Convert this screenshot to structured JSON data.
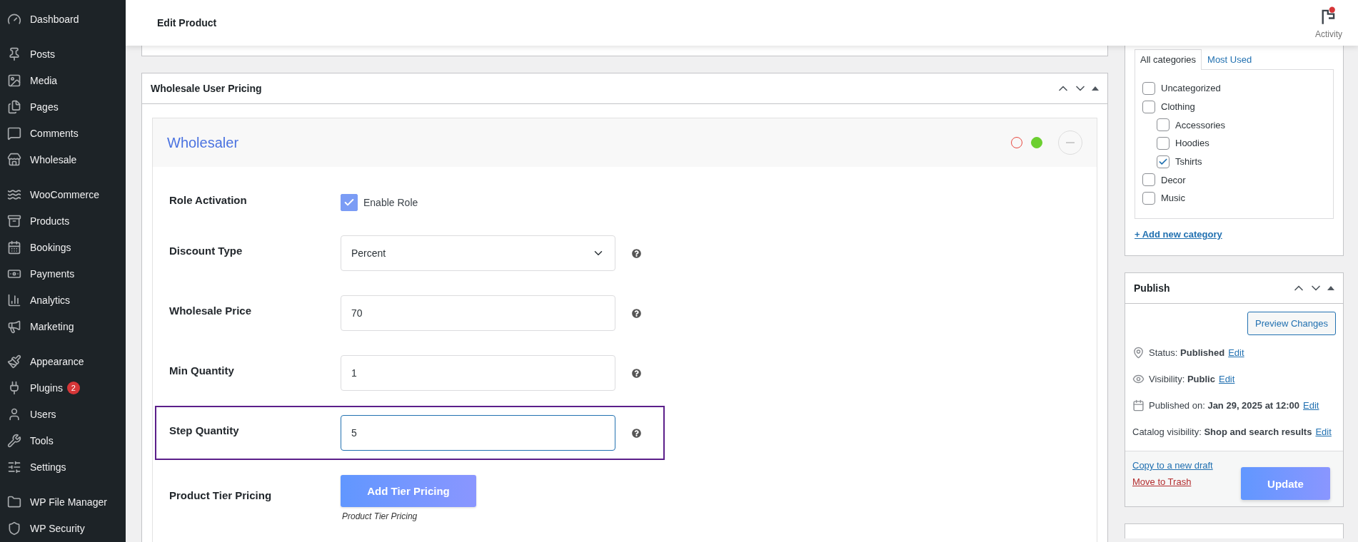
{
  "sidebar": {
    "groups": [
      {
        "items": [
          {
            "label": "Dashboard"
          }
        ]
      },
      {
        "items": [
          {
            "label": "Posts"
          },
          {
            "label": "Media"
          },
          {
            "label": "Pages"
          },
          {
            "label": "Comments"
          },
          {
            "label": "Wholesale"
          }
        ]
      },
      {
        "items": [
          {
            "label": "WooCommerce"
          },
          {
            "label": "Products"
          },
          {
            "label": "Bookings"
          },
          {
            "label": "Payments"
          },
          {
            "label": "Analytics"
          },
          {
            "label": "Marketing"
          }
        ]
      },
      {
        "items": [
          {
            "label": "Appearance"
          },
          {
            "label": "Plugins",
            "badge": "2"
          },
          {
            "label": "Users"
          },
          {
            "label": "Tools"
          },
          {
            "label": "Settings"
          }
        ]
      },
      {
        "items": [
          {
            "label": "WP File Manager"
          },
          {
            "label": "WP Security"
          }
        ]
      }
    ]
  },
  "header": {
    "title": "Edit Product",
    "activity": {
      "label": "Activity",
      "unread": true
    }
  },
  "wholesale_box": {
    "title": "Wholesale User Pricing",
    "role_card": {
      "name": "Wholesaler",
      "status_dots": [
        {
          "color": "#e8473f",
          "filled": false
        },
        {
          "color": "#6ccf30",
          "filled": true
        }
      ],
      "rows": [
        {
          "kind": "checkbox",
          "label": "Role Activation",
          "option": "Enable Role",
          "checked": true
        },
        {
          "kind": "select",
          "label": "Discount Type",
          "value": "Percent",
          "focused": false,
          "highlighted": false
        },
        {
          "kind": "input",
          "label": "Wholesale Price",
          "value": "70",
          "focused": false,
          "highlighted": false
        },
        {
          "kind": "input",
          "label": "Min Quantity",
          "value": "1",
          "focused": false,
          "highlighted": false
        },
        {
          "kind": "input",
          "label": "Step Quantity",
          "value": "5",
          "focused": true,
          "highlighted": true
        },
        {
          "kind": "button",
          "label": "Product Tier Pricing",
          "button": "Add Tier Pricing",
          "caption": "Product Tier Pricing"
        }
      ]
    }
  },
  "categories": {
    "tabs": [
      {
        "label": "All categories",
        "selected": true
      },
      {
        "label": "Most Used",
        "selected": false
      }
    ],
    "items": [
      {
        "label": "Uncategorized",
        "checked": false
      },
      {
        "label": "Clothing",
        "checked": false,
        "children": [
          {
            "label": "Accessories",
            "checked": false
          },
          {
            "label": "Hoodies",
            "checked": false
          },
          {
            "label": "Tshirts",
            "checked": true
          }
        ]
      },
      {
        "label": "Decor",
        "checked": false
      },
      {
        "label": "Music",
        "checked": false
      }
    ],
    "add_link": "+ Add new category"
  },
  "publish": {
    "title": "Publish",
    "preview_button": "Preview Changes",
    "meta": [
      {
        "kind": "status",
        "text": "Status: **Published**",
        "link": "Edit"
      },
      {
        "kind": "visibility",
        "text": "Visibility: **Public**",
        "link": "Edit"
      },
      {
        "kind": "date",
        "text": "Published on: **Jan 29, 2025 at 12:00**",
        "link": "Edit"
      },
      {
        "kind": "catalog",
        "text": "Catalog visibility: **Shop and search results**",
        "link": "Edit"
      }
    ],
    "copy_link": "Copy to a new draft",
    "trash_link": "Move to Trash",
    "update_button": "Update"
  }
}
